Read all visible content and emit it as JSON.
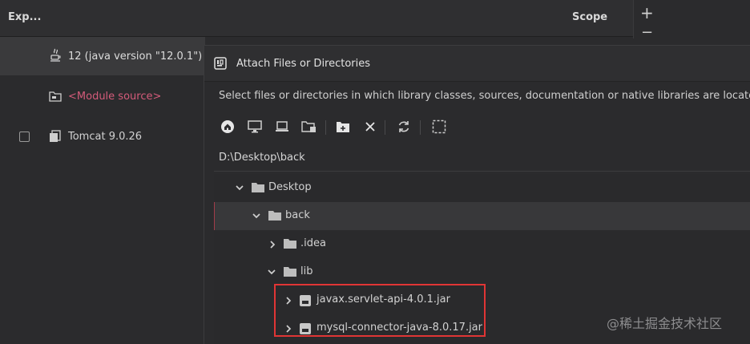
{
  "background_panel": {
    "col_export": "Exp...",
    "col_scope": "Scope",
    "add_label": "+",
    "remove_label": "−",
    "rows": [
      {
        "label": "12 (java version \"12.0.1\")"
      },
      {
        "label": "<Module source>"
      },
      {
        "label": "Tomcat 9.0.26"
      }
    ]
  },
  "dialog": {
    "title": "Attach Files or Directories",
    "description": "Select files or directories in which library classes, sources, documentation or native libraries are located",
    "path": "D:\\Desktop\\back",
    "toolbar": [
      {
        "icon": "home-icon"
      },
      {
        "icon": "desktop-icon"
      },
      {
        "icon": "laptop-icon"
      },
      {
        "icon": "module-folder-icon"
      },
      {
        "icon": "new-folder-icon"
      },
      {
        "icon": "delete-icon"
      },
      {
        "icon": "refresh-icon"
      },
      {
        "icon": "show-hidden-icon"
      }
    ],
    "tree": [
      {
        "label": "Desktop",
        "kind": "folder",
        "expanded": true
      },
      {
        "label": "back",
        "kind": "folder",
        "expanded": true,
        "selected": true
      },
      {
        "label": ".idea",
        "kind": "folder",
        "expanded": false
      },
      {
        "label": "lib",
        "kind": "folder",
        "expanded": true
      },
      {
        "label": "javax.servlet-api-4.0.1.jar",
        "kind": "jar",
        "expanded": false
      },
      {
        "label": "mysql-connector-java-8.0.17.jar",
        "kind": "jar",
        "expanded": false
      }
    ]
  },
  "watermark": "@稀土掘金技术社区",
  "colors": {
    "accent_red": "#e03535",
    "module_source": "#d45b7a",
    "selection_border": "#a23c4a"
  }
}
